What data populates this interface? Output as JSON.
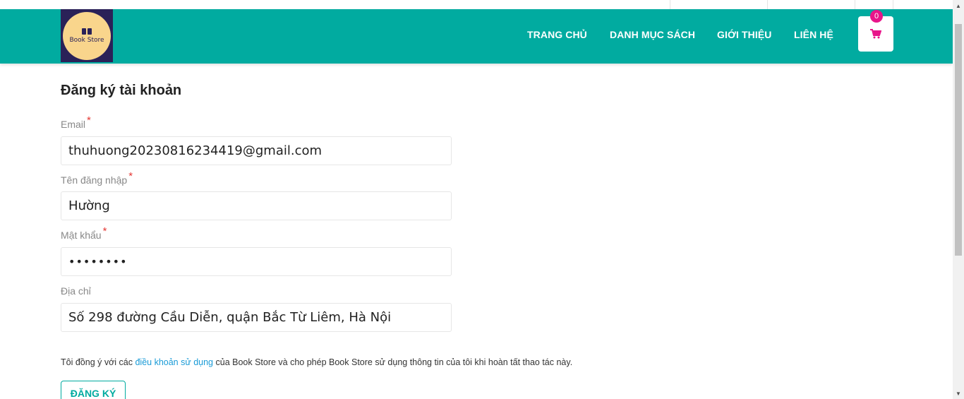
{
  "header": {
    "logo_text": "Book Store",
    "nav": [
      {
        "label": "TRANG CHỦ"
      },
      {
        "label": "DANH MỤC SÁCH"
      },
      {
        "label": "GIỚI THIỆU"
      },
      {
        "label": "LIÊN HỆ"
      }
    ],
    "cart_count": "0",
    "cart_icon": "shopping-cart-icon"
  },
  "form": {
    "title": "Đăng ký tài khoản",
    "email_label": "Email",
    "email_value": "thuhuong20230816234419@gmail.com",
    "username_label": "Tên đăng nhập",
    "username_value": "Hường",
    "password_label": "Mật khẩu",
    "password_value": "••••••••",
    "address_label": "Địa chỉ",
    "address_value": " Số 298 đường Cầu Diễn, quận Bắc Từ Liêm, Hà Nội",
    "required_mark": "*",
    "agree_prefix": "Tôi đồng ý với các ",
    "agree_link": "điều khoản sử dụng",
    "agree_suffix": " của Book Store và cho phép Book Store sử dụng thông tin của tôi khi hoàn tất thao tác này.",
    "submit_label": "ĐĂNG KÝ"
  },
  "colors": {
    "primary": "#01aba0",
    "badge": "#e8158a",
    "link": "#1a9bd7",
    "required": "#e53935"
  }
}
